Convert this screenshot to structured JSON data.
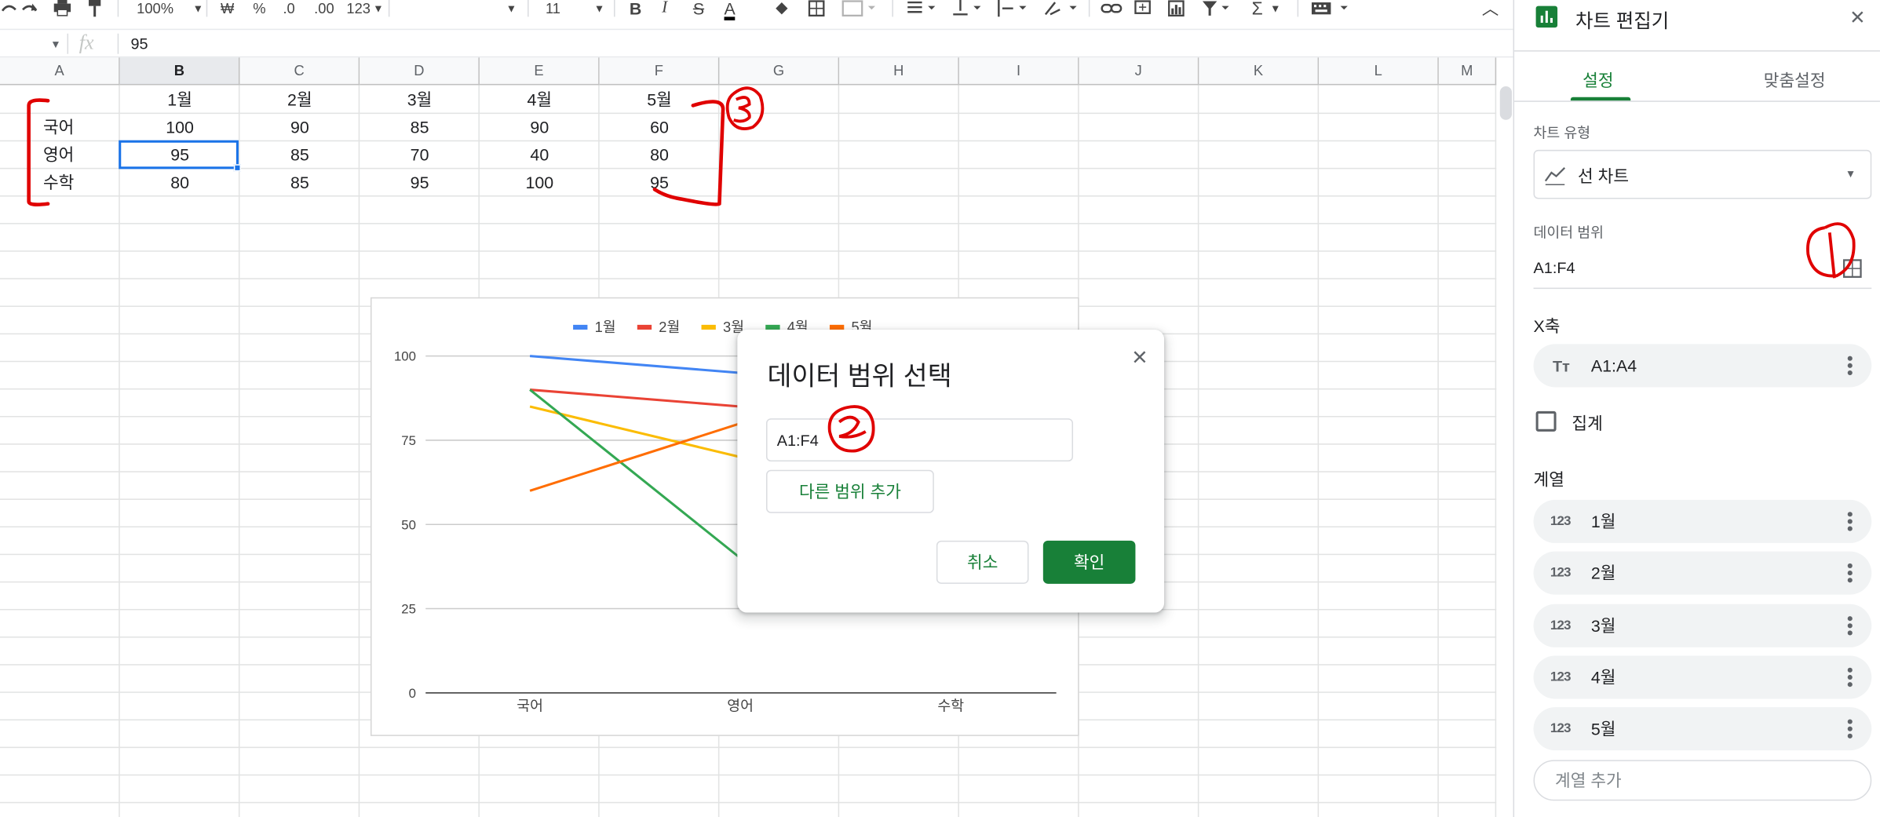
{
  "toolbar": {
    "zoom": "100%",
    "currency": "₩",
    "percent": "%",
    "dec_decrease": ".0",
    "dec_increase": ".00",
    "more_formats": "123",
    "font_size": "11"
  },
  "formula_bar": {
    "fx_label": "fx",
    "value": "95"
  },
  "columns": [
    "A",
    "B",
    "C",
    "D",
    "E",
    "F",
    "G",
    "H",
    "I",
    "J",
    "K",
    "L",
    "M"
  ],
  "sheet": {
    "header_row": [
      "",
      "1월",
      "2월",
      "3월",
      "4월",
      "5월"
    ],
    "rows": [
      [
        "국어",
        "100",
        "90",
        "85",
        "90",
        "60"
      ],
      [
        "영어",
        "95",
        "85",
        "70",
        "40",
        "80"
      ],
      [
        "수학",
        "80",
        "85",
        "95",
        "100",
        "95"
      ]
    ]
  },
  "chart_data": {
    "type": "line",
    "categories": [
      "국어",
      "영어",
      "수학"
    ],
    "series": [
      {
        "name": "1월",
        "color": "#4285f4",
        "values": [
          100,
          95,
          80
        ]
      },
      {
        "name": "2월",
        "color": "#ea4335",
        "values": [
          90,
          85,
          85
        ]
      },
      {
        "name": "3월",
        "color": "#fbbc04",
        "values": [
          85,
          70,
          95
        ]
      },
      {
        "name": "4월",
        "color": "#34a853",
        "values": [
          90,
          40,
          100
        ]
      },
      {
        "name": "5월",
        "color": "#ff6d01",
        "values": [
          60,
          80,
          95
        ]
      }
    ],
    "ylim": [
      0,
      100
    ],
    "yticks": [
      "100",
      "75",
      "50",
      "25",
      "0"
    ],
    "legend": "top",
    "grid": true
  },
  "dialog": {
    "title": "데이터 범위 선택",
    "range_value": "A1:F4",
    "add_range_label": "다른 범위 추가",
    "cancel_label": "취소",
    "ok_label": "확인",
    "close_icon": "×"
  },
  "panel": {
    "title": "차트 편집기",
    "close_icon": "✕",
    "tabs": [
      "설정",
      "맞춤설정"
    ],
    "chart_type_label": "차트 유형",
    "chart_type_value": "선 차트",
    "data_range_label": "데이터 범위",
    "data_range_value": "A1:F4",
    "x_axis_label": "X축",
    "x_axis_value": "A1:A4",
    "aggregate_label": "집계",
    "series_label": "계열",
    "series": [
      "1월",
      "2월",
      "3월",
      "4월",
      "5월"
    ],
    "series_icon": "123",
    "add_series_label": "계열 추가"
  },
  "colors": {
    "accent_green": "#188038",
    "selection_blue": "#1a73e8",
    "annotation_red": "#e00000"
  }
}
